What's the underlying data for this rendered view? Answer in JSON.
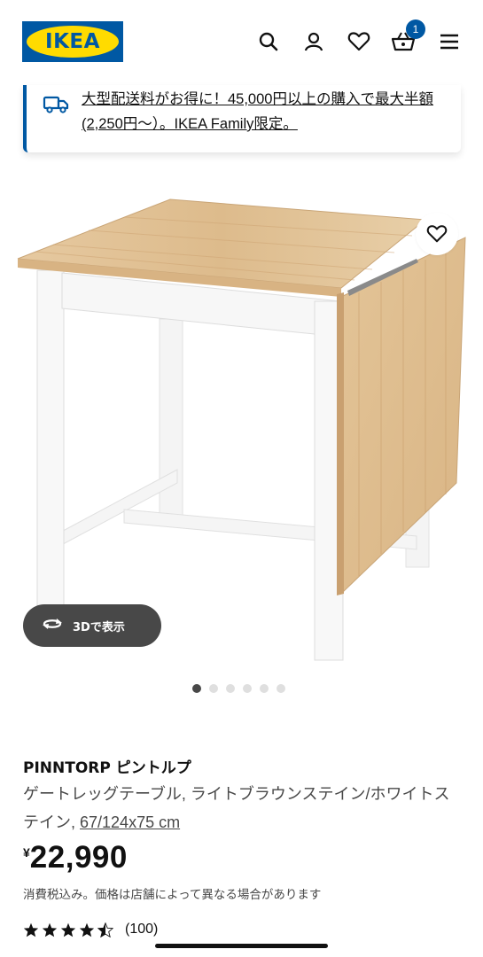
{
  "header": {
    "logo_text": "IKEA",
    "cart_count": "1",
    "icons": [
      "search-icon",
      "user-icon",
      "heart-icon",
      "cart-icon",
      "menu-icon"
    ]
  },
  "banner": {
    "icon": "truck-icon",
    "text": "大型配送料がお得に！45,000円以上の購入で最大半額(2,250円〜）。IKEA Family限定。"
  },
  "gallery": {
    "view_3d_label": "3Dで表示",
    "dot_count": 6,
    "active_dot": 1
  },
  "product": {
    "name": "PINNTORP ピントルプ",
    "description": "ゲートレッグテーブル, ライトブラウンステイン/ホワイトステイン, ",
    "dimensions": "67/124x75 cm",
    "currency": "¥",
    "price": "22,990",
    "tax_note": "消費税込み。価格は店舗によって異なる場合があります",
    "rating": 4.5,
    "review_count": "(100)"
  },
  "colors": {
    "brand_blue": "#0058a3",
    "brand_yellow": "#ffdb00",
    "dark_button": "#484848"
  }
}
